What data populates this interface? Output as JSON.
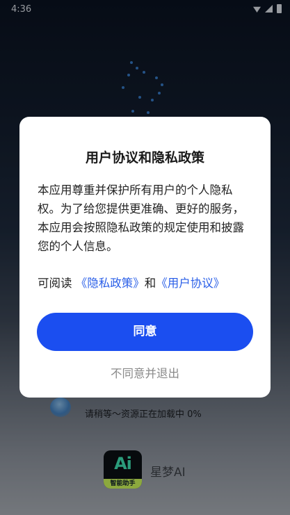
{
  "status_bar": {
    "time": "4:36"
  },
  "dialog": {
    "title": "用户协议和隐私政策",
    "body": "本应用尊重并保护所有用户的个人隐私权。为了给您提供更准确、更好的服务，本应用会按照隐私政策的规定使用和披露您的个人信息。",
    "links_prefix": "可阅读 ",
    "privacy_link": "《隐私政策》",
    "links_joiner": "和",
    "agreement_link": "《用户协议》",
    "agree_label": "同意",
    "decline_label": "不同意并退出"
  },
  "splash": {
    "loading_text": "请稍等～资源正在加载中 0%",
    "logo_text": "Ai",
    "logo_subtext": "智能助手",
    "app_name": "星梦AI"
  },
  "colors": {
    "accent": "#1b4ef0",
    "link": "#2a5fe8",
    "decline_text": "#8a8a8a"
  }
}
